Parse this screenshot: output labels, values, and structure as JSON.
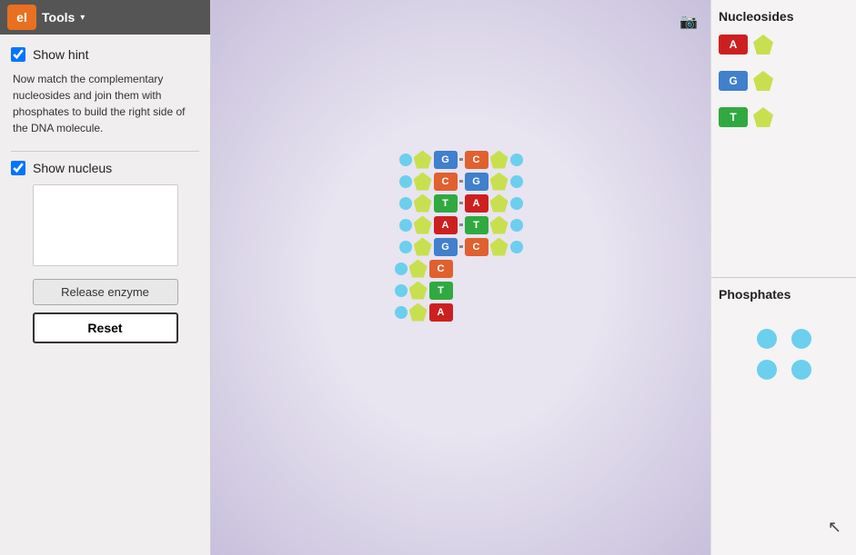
{
  "toolbar": {
    "logo_text": "el",
    "title": "Tools",
    "arrow": "▾"
  },
  "left_panel": {
    "show_hint_label": "Show hint",
    "show_hint_checked": true,
    "hint_text": "Now match the complementary nucleosides and join them with phosphates to build the right side of the DNA molecule.",
    "show_nucleus_label": "Show nucleus",
    "show_nucleus_checked": true,
    "release_enzyme_label": "Release enzyme",
    "reset_label": "Reset"
  },
  "right_panel": {
    "nucleosides_title": "Nucleosides",
    "nucleosides": [
      {
        "letter": "A",
        "color": "#cc2020"
      },
      {
        "letter": "G",
        "color": "#4080cc"
      },
      {
        "letter": "T",
        "color": "#30aa40"
      }
    ],
    "phosphates_title": "Phosphates",
    "phosphate_rows": [
      [
        1,
        2
      ],
      [
        3,
        4
      ]
    ]
  },
  "dna": {
    "rows": [
      {
        "left": [
          "G",
          "C"
        ],
        "right": []
      },
      {
        "left": [
          "C",
          "G"
        ],
        "right": []
      },
      {
        "left": [
          "T",
          "A"
        ],
        "right": []
      },
      {
        "left": [
          "A",
          "T"
        ],
        "right": []
      },
      {
        "left": [
          "G",
          "C"
        ],
        "right": []
      },
      {
        "left": [
          "C"
        ],
        "right": []
      },
      {
        "left": [
          "T"
        ],
        "right": []
      },
      {
        "left": [
          "A"
        ],
        "right": []
      }
    ]
  }
}
